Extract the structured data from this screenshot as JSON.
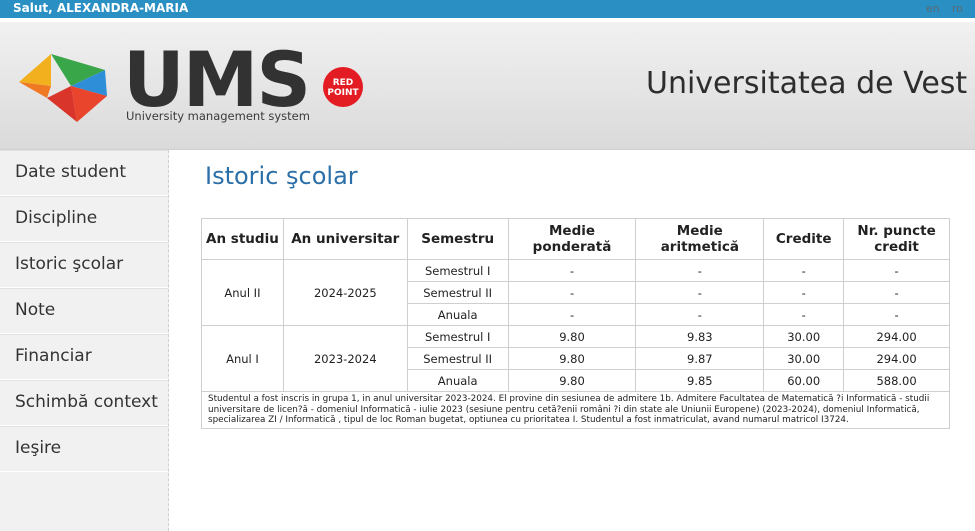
{
  "topbar": {
    "greeting": "Salut, ALEXANDRA-MARIA",
    "lang_en": "en",
    "lang_ro": "ro",
    "color": "#2a8fc3"
  },
  "header": {
    "logo_text": "UMS",
    "logo_subtitle": "University management system",
    "badge_line1": "RED",
    "badge_line2": "POINT",
    "university": "Universitatea de Vest"
  },
  "sidebar": {
    "items": [
      {
        "label": "Date student"
      },
      {
        "label": "Discipline"
      },
      {
        "label": "Istoric şcolar"
      },
      {
        "label": "Note"
      },
      {
        "label": "Financiar"
      },
      {
        "label": "Schimbă context"
      },
      {
        "label": "Ieşire"
      }
    ]
  },
  "main": {
    "title": "Istoric şcolar",
    "table": {
      "headers": [
        "An studiu",
        "An universitar",
        "Semestru",
        "Medie ponderată",
        "Medie aritmetică",
        "Credite",
        "Nr. puncte credit"
      ],
      "groups": [
        {
          "an_studiu": "Anul II",
          "an_universitar": "2024-2025",
          "rows": [
            {
              "semestru": "Semestrul I",
              "medie_ponderata": "-",
              "medie_aritmetica": "-",
              "credite": "-",
              "puncte": "-"
            },
            {
              "semestru": "Semestrul II",
              "medie_ponderata": "-",
              "medie_aritmetica": "-",
              "credite": "-",
              "puncte": "-"
            },
            {
              "semestru": "Anuala",
              "medie_ponderata": "-",
              "medie_aritmetica": "-",
              "credite": "-",
              "puncte": "-"
            }
          ]
        },
        {
          "an_studiu": "Anul I",
          "an_universitar": "2023-2024",
          "rows": [
            {
              "semestru": "Semestrul I",
              "medie_ponderata": "9.80",
              "medie_aritmetica": "9.83",
              "credite": "30.00",
              "puncte": "294.00"
            },
            {
              "semestru": "Semestrul II",
              "medie_ponderata": "9.80",
              "medie_aritmetica": "9.87",
              "credite": "30.00",
              "puncte": "294.00"
            },
            {
              "semestru": "Anuala",
              "medie_ponderata": "9.80",
              "medie_aritmetica": "9.85",
              "credite": "60.00",
              "puncte": "588.00"
            }
          ]
        }
      ],
      "note": "Studentul a fost inscris in grupa 1, in anul universitar 2023-2024. El provine din sesiunea de admitere 1b. Admitere Facultatea de Matematică ?i Informatică - studii universitare de licen?ă - domeniul Informatică - iulie 2023 (sesiune pentru cetă?enii români ?i din state ale Uniunii Europene) (2023-2024), domeniul Informatică, specializarea ZI / Informatică , tipul de loc Roman bugetat, optiunea cu prioritatea I. Studentul a fost inmatriculat, avand numarul matricol I3724."
    }
  }
}
